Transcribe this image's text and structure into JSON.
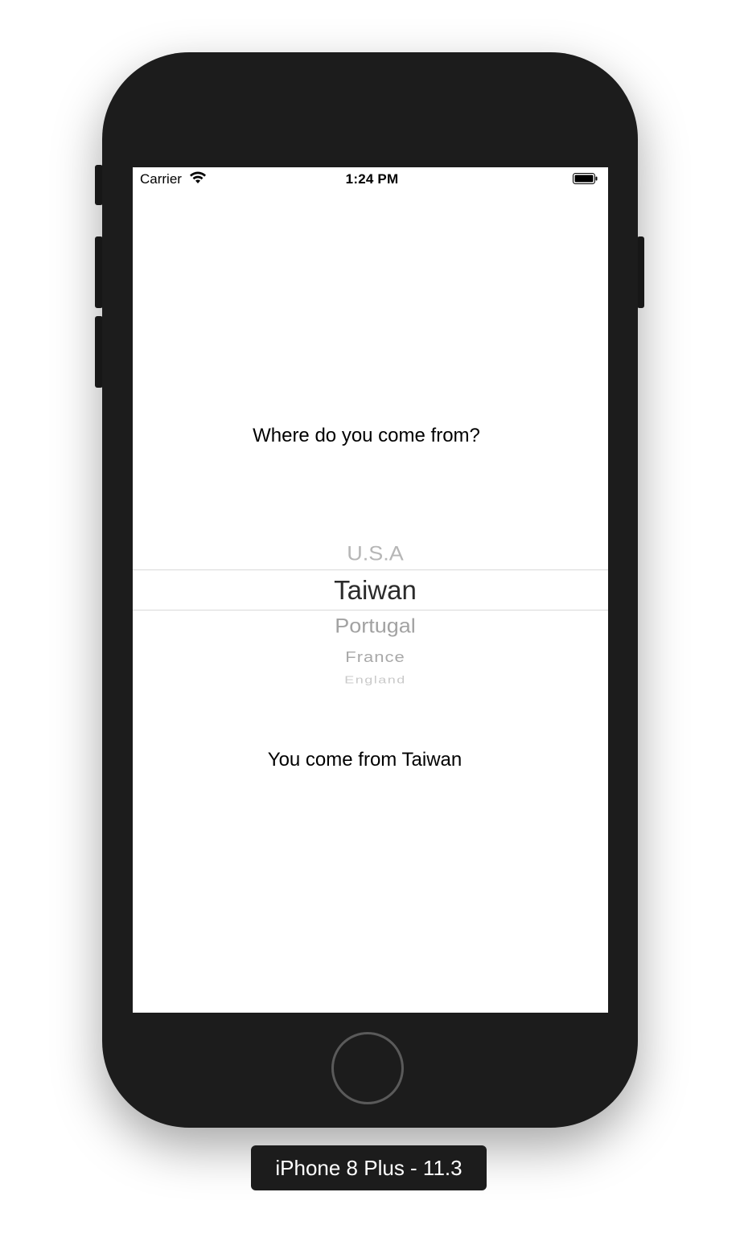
{
  "status_bar": {
    "carrier": "Carrier",
    "time": "1:24 PM",
    "wifi_icon": "wifi-icon",
    "battery_icon": "battery-icon"
  },
  "main": {
    "question": "Where do you come from?",
    "picker": {
      "items": [
        "U.S.A",
        "Taiwan",
        "Portugal",
        "France",
        "England"
      ],
      "selected": "Taiwan"
    },
    "result": "You come from Taiwan"
  },
  "device_label": "iPhone 8 Plus - 11.3",
  "colors": {
    "device_body": "#1c1c1c",
    "screen_background": "#ffffff",
    "picker_selected_text": "#2b2b2b",
    "picker_faded_text": "#b6b6b6",
    "picker_divider": "#d9d9d9"
  }
}
